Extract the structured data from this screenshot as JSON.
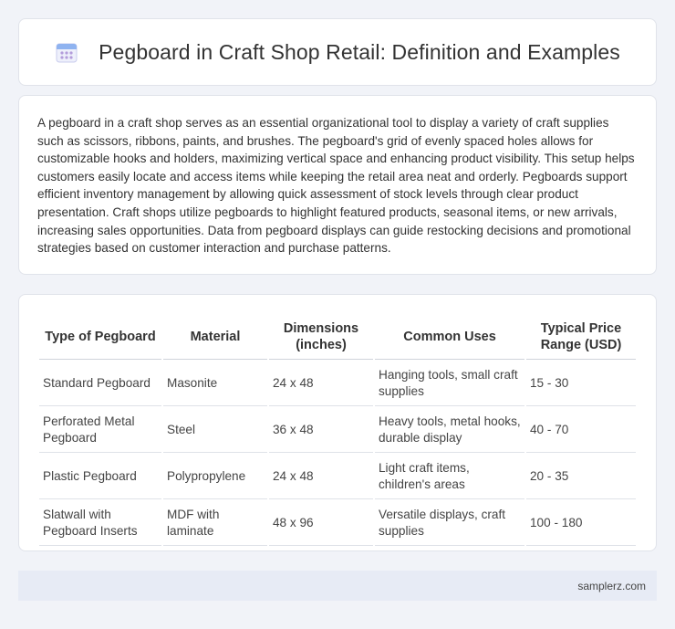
{
  "header": {
    "icon": "calendar-icon",
    "title": "Pegboard in Craft Shop Retail: Definition and Examples"
  },
  "intro": {
    "text": "A pegboard in a craft shop serves as an essential organizational tool to display a variety of craft supplies such as scissors, ribbons, paints, and brushes. The pegboard's grid of evenly spaced holes allows for customizable hooks and holders, maximizing vertical space and enhancing product visibility. This setup helps customers easily locate and access items while keeping the retail area neat and orderly. Pegboards support efficient inventory management by allowing quick assessment of stock levels through clear product presentation. Craft shops utilize pegboards to highlight featured products, seasonal items, or new arrivals, increasing sales opportunities. Data from pegboard displays can guide restocking decisions and promotional strategies based on customer interaction and purchase patterns."
  },
  "table": {
    "headers": [
      "Type of Pegboard",
      "Material",
      "Dimensions (inches)",
      "Common Uses",
      "Typical Price Range (USD)"
    ],
    "rows": [
      [
        "Standard Pegboard",
        "Masonite",
        "24 x 48",
        "Hanging tools, small craft supplies",
        "15 - 30"
      ],
      [
        "Perforated Metal Pegboard",
        "Steel",
        "36 x 48",
        "Heavy tools, metal hooks, durable display",
        "40 - 70"
      ],
      [
        "Plastic Pegboard",
        "Polypropylene",
        "24 x 48",
        "Light craft items, children's areas",
        "20 - 35"
      ],
      [
        "Slatwall with Pegboard Inserts",
        "MDF with laminate",
        "48 x 96",
        "Versatile displays, craft supplies",
        "100 - 180"
      ]
    ]
  },
  "footer": {
    "site": "samplerz.com"
  },
  "colors": {
    "background": "#f1f3f8",
    "card": "#ffffff",
    "footer": "#e7ebf5",
    "icon_accent": "#8a7fd6"
  }
}
